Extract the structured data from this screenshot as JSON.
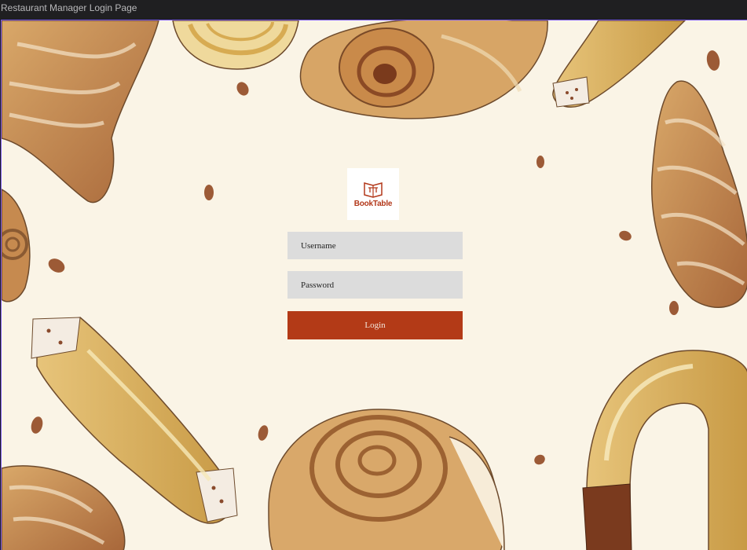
{
  "window": {
    "title": "Restaurant Manager Login Page"
  },
  "brand": {
    "name": "BookTable",
    "color": "#b3391b"
  },
  "form": {
    "username_placeholder": "Username",
    "password_placeholder": "Password",
    "login_label": "Login",
    "button_color": "#b33a17",
    "field_color": "#dcdcdc"
  },
  "background": {
    "color": "#faf4e6",
    "theme": "watercolor pastries"
  }
}
